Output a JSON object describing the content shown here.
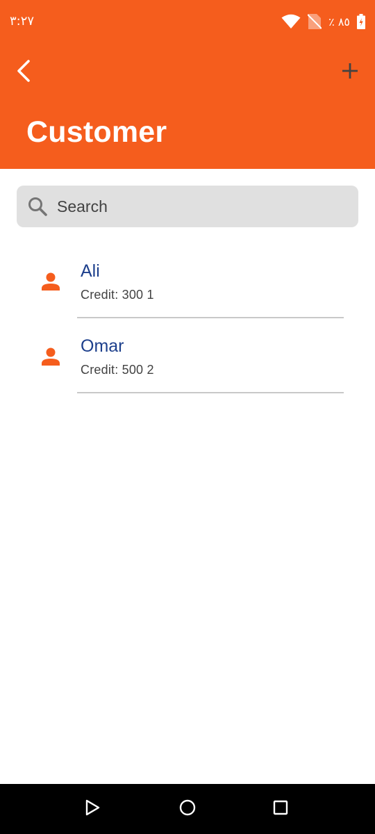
{
  "status_bar": {
    "time": "٣:٢٧",
    "battery_text": "٪ ٨٥",
    "icons": [
      "wifi-icon",
      "no-sim-icon",
      "battery-charging-icon"
    ]
  },
  "header": {
    "title": "Customer",
    "back_icon": "chevron-left-icon",
    "add_icon": "plus-icon",
    "color": "#f55d1d"
  },
  "search": {
    "placeholder": "Search",
    "value": "",
    "icon": "search-icon"
  },
  "customers": [
    {
      "name": "Ali",
      "credit": "Credit: 300 1",
      "icon": "person-icon"
    },
    {
      "name": "Omar",
      "credit": "Credit: 500 2",
      "icon": "person-icon"
    }
  ],
  "nav_bar": {
    "icons": [
      "back-triangle-icon",
      "home-circle-icon",
      "recents-square-icon"
    ]
  },
  "colors": {
    "accent": "#f55d1d",
    "name_text": "#1d3f8c",
    "secondary_text": "#424242",
    "search_bg": "#e0e0e0"
  }
}
